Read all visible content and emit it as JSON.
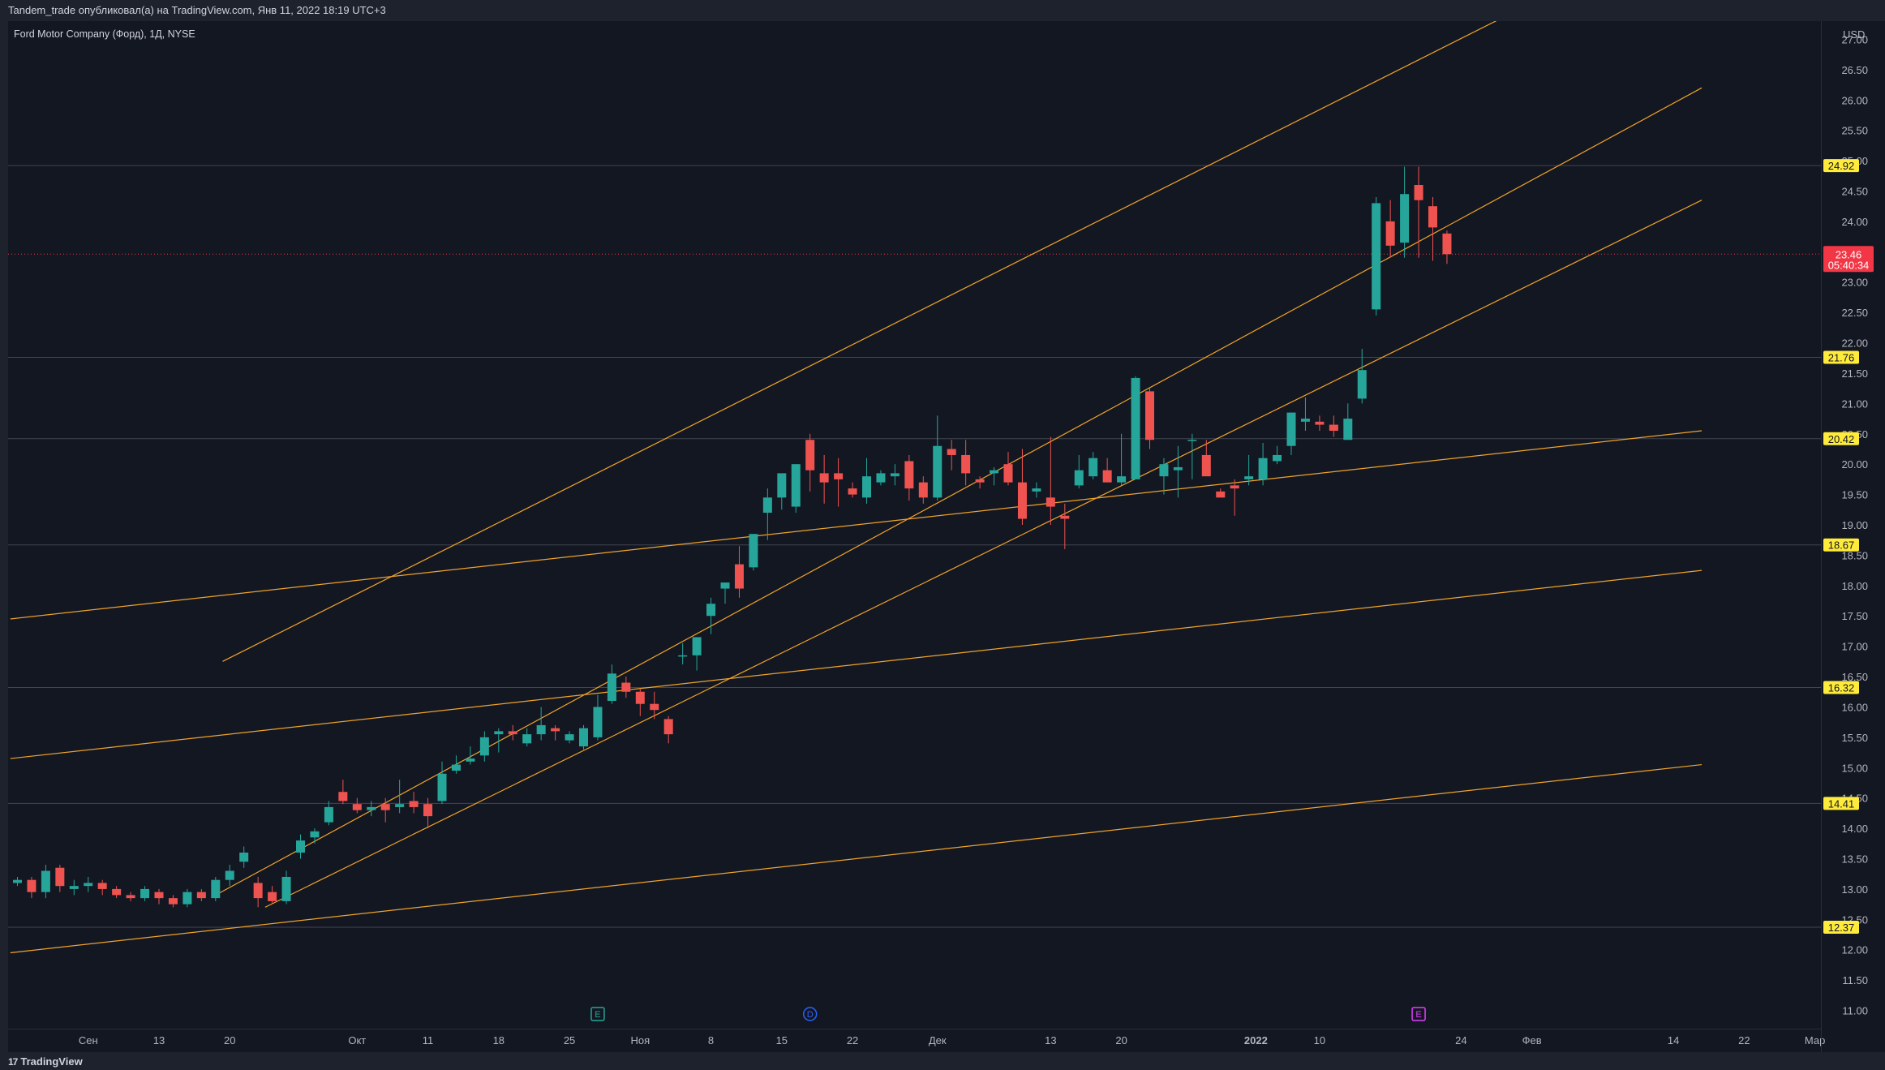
{
  "header": {
    "published": "Tandem_trade опубликовал(а) на TradingView.com, Янв 11, 2022 18:19 UTC+3"
  },
  "footer": {
    "brand": "TradingView"
  },
  "colors": {
    "up": "#26a69a",
    "down": "#ef5350",
    "trendline": "#f0a32a",
    "level_label": "#ffeb3b",
    "current": "#f23645",
    "background": "#131722"
  },
  "chart_data": {
    "type": "candlestick",
    "symbol": "Ford Motor Company (Форд), 1Д, NYSE",
    "currency": "USD",
    "ylim": [
      10.7,
      27.3
    ],
    "y_ticks": [
      "11.00",
      "11.50",
      "12.00",
      "12.50",
      "13.00",
      "13.50",
      "14.00",
      "14.50",
      "15.00",
      "15.50",
      "16.00",
      "16.50",
      "17.00",
      "17.50",
      "18.00",
      "18.50",
      "19.00",
      "19.50",
      "20.00",
      "20.50",
      "21.00",
      "21.50",
      "22.00",
      "22.50",
      "23.00",
      "23.50",
      "24.00",
      "24.50",
      "25.00",
      "25.50",
      "26.00",
      "26.50",
      "27.00"
    ],
    "x_ticks": [
      {
        "label": "Сен",
        "i": 5
      },
      {
        "label": "13",
        "i": 10
      },
      {
        "label": "20",
        "i": 15
      },
      {
        "label": "Окт",
        "i": 24
      },
      {
        "label": "11",
        "i": 29
      },
      {
        "label": "18",
        "i": 34
      },
      {
        "label": "25",
        "i": 39
      },
      {
        "label": "Ноя",
        "i": 44
      },
      {
        "label": "8",
        "i": 49
      },
      {
        "label": "15",
        "i": 54
      },
      {
        "label": "22",
        "i": 59
      },
      {
        "label": "Дек",
        "i": 65
      },
      {
        "label": "13",
        "i": 73
      },
      {
        "label": "20",
        "i": 78
      },
      {
        "label": "2022",
        "i": 87.5
      },
      {
        "label": "10",
        "i": 92
      },
      {
        "label": "24",
        "i": 102
      },
      {
        "label": "Фев",
        "i": 107
      },
      {
        "label": "14",
        "i": 117
      },
      {
        "label": "22",
        "i": 122
      },
      {
        "label": "Мар",
        "i": 127
      }
    ],
    "candles": [
      [
        13.1,
        13.2,
        13.05,
        13.15
      ],
      [
        13.15,
        13.2,
        12.85,
        12.95
      ],
      [
        12.95,
        13.4,
        12.85,
        13.3
      ],
      [
        13.35,
        13.4,
        12.95,
        13.05
      ],
      [
        13.0,
        13.15,
        12.9,
        13.05
      ],
      [
        13.05,
        13.2,
        12.95,
        13.1
      ],
      [
        13.1,
        13.15,
        12.9,
        13.0
      ],
      [
        13.0,
        13.05,
        12.85,
        12.9
      ],
      [
        12.9,
        12.95,
        12.8,
        12.85
      ],
      [
        12.85,
        13.05,
        12.8,
        13.0
      ],
      [
        12.95,
        13.0,
        12.75,
        12.85
      ],
      [
        12.85,
        12.9,
        12.7,
        12.75
      ],
      [
        12.75,
        13.0,
        12.7,
        12.95
      ],
      [
        12.95,
        13.0,
        12.8,
        12.85
      ],
      [
        12.85,
        13.2,
        12.8,
        13.15
      ],
      [
        13.15,
        13.4,
        13.05,
        13.3
      ],
      [
        13.45,
        13.7,
        13.35,
        13.6
      ],
      [
        13.1,
        13.2,
        12.7,
        12.85
      ],
      [
        12.95,
        13.05,
        12.75,
        12.8
      ],
      [
        12.8,
        13.3,
        12.75,
        13.2
      ],
      [
        13.6,
        13.9,
        13.5,
        13.8
      ],
      [
        13.85,
        14.0,
        13.75,
        13.95
      ],
      [
        14.1,
        14.45,
        14.05,
        14.35
      ],
      [
        14.6,
        14.8,
        14.4,
        14.45
      ],
      [
        14.4,
        14.5,
        14.25,
        14.3
      ],
      [
        14.3,
        14.45,
        14.2,
        14.35
      ],
      [
        14.4,
        14.5,
        14.1,
        14.3
      ],
      [
        14.35,
        14.8,
        14.25,
        14.4
      ],
      [
        14.45,
        14.6,
        14.25,
        14.35
      ],
      [
        14.4,
        14.5,
        14.0,
        14.2
      ],
      [
        14.45,
        15.1,
        14.4,
        14.9
      ],
      [
        14.95,
        15.2,
        14.9,
        15.05
      ],
      [
        15.1,
        15.35,
        15.05,
        15.15
      ],
      [
        15.2,
        15.6,
        15.1,
        15.5
      ],
      [
        15.55,
        15.65,
        15.25,
        15.6
      ],
      [
        15.6,
        15.7,
        15.45,
        15.55
      ],
      [
        15.4,
        15.65,
        15.35,
        15.55
      ],
      [
        15.55,
        16.0,
        15.45,
        15.7
      ],
      [
        15.65,
        15.7,
        15.45,
        15.6
      ],
      [
        15.45,
        15.6,
        15.4,
        15.55
      ],
      [
        15.35,
        15.7,
        15.3,
        15.65
      ],
      [
        15.5,
        16.2,
        15.45,
        16.0
      ],
      [
        16.1,
        16.7,
        16.05,
        16.55
      ],
      [
        16.4,
        16.5,
        16.15,
        16.25
      ],
      [
        16.25,
        16.3,
        15.85,
        16.05
      ],
      [
        16.05,
        16.25,
        15.8,
        15.95
      ],
      [
        15.8,
        15.85,
        15.4,
        15.55
      ],
      [
        16.85,
        17.05,
        16.7,
        16.85
      ],
      [
        16.85,
        17.15,
        16.6,
        17.15
      ],
      [
        17.5,
        17.8,
        17.2,
        17.7
      ],
      [
        17.95,
        18.0,
        17.7,
        18.05
      ],
      [
        18.35,
        18.65,
        17.8,
        17.95
      ],
      [
        18.3,
        18.85,
        18.25,
        18.85
      ],
      [
        19.2,
        19.6,
        18.75,
        19.45
      ],
      [
        19.45,
        19.8,
        19.25,
        19.85
      ],
      [
        19.3,
        20.0,
        19.2,
        20.0
      ],
      [
        20.4,
        20.5,
        19.55,
        19.9
      ],
      [
        19.85,
        20.15,
        19.35,
        19.7
      ],
      [
        19.85,
        20.1,
        19.3,
        19.75
      ],
      [
        19.6,
        19.7,
        19.45,
        19.5
      ],
      [
        19.45,
        20.1,
        19.35,
        19.8
      ],
      [
        19.7,
        19.9,
        19.65,
        19.85
      ],
      [
        19.8,
        20.0,
        19.65,
        19.85
      ],
      [
        20.05,
        20.15,
        19.4,
        19.6
      ],
      [
        19.7,
        19.8,
        19.35,
        19.45
      ],
      [
        19.45,
        20.8,
        19.4,
        20.3
      ],
      [
        20.25,
        20.4,
        19.9,
        20.15
      ],
      [
        20.15,
        20.4,
        19.65,
        19.85
      ],
      [
        19.75,
        19.8,
        19.6,
        19.7
      ],
      [
        19.85,
        19.95,
        19.65,
        19.9
      ],
      [
        20.0,
        20.2,
        19.65,
        19.7
      ],
      [
        19.7,
        20.25,
        19.0,
        19.1
      ],
      [
        19.55,
        19.7,
        19.45,
        19.6
      ],
      [
        19.45,
        20.45,
        19.0,
        19.3
      ],
      [
        19.15,
        19.35,
        18.6,
        19.1
      ],
      [
        19.65,
        20.15,
        19.6,
        19.9
      ],
      [
        19.8,
        20.2,
        19.75,
        20.1
      ],
      [
        19.9,
        20.1,
        19.7,
        19.7
      ],
      [
        19.7,
        20.5,
        19.65,
        19.8
      ],
      [
        19.75,
        21.45,
        19.75,
        21.42
      ],
      [
        21.2,
        21.25,
        20.25,
        20.4
      ],
      [
        19.8,
        20.1,
        19.5,
        20.0
      ],
      [
        19.9,
        20.3,
        19.45,
        19.95
      ],
      [
        20.4,
        20.5,
        19.75,
        20.4
      ],
      [
        20.15,
        20.4,
        19.95,
        19.8
      ],
      [
        19.55,
        19.6,
        19.5,
        19.45
      ],
      [
        19.65,
        19.75,
        19.15,
        19.6
      ],
      [
        19.75,
        20.15,
        19.65,
        19.8
      ],
      [
        19.75,
        20.35,
        19.65,
        20.1
      ],
      [
        20.05,
        20.3,
        20.0,
        20.15
      ],
      [
        20.3,
        20.85,
        20.15,
        20.85
      ],
      [
        20.7,
        21.1,
        20.55,
        20.75
      ],
      [
        20.7,
        20.8,
        20.55,
        20.65
      ],
      [
        20.65,
        20.8,
        20.45,
        20.55
      ],
      [
        20.4,
        21.0,
        20.4,
        20.75
      ],
      [
        21.08,
        21.9,
        21.0,
        21.55
      ],
      [
        22.55,
        24.4,
        22.45,
        24.3
      ],
      [
        24.0,
        24.35,
        23.4,
        23.6
      ],
      [
        23.65,
        24.9,
        23.4,
        24.45
      ],
      [
        24.6,
        24.9,
        23.4,
        24.35
      ],
      [
        24.25,
        24.4,
        23.35,
        23.9
      ],
      [
        23.8,
        23.85,
        23.3,
        23.46
      ]
    ],
    "trendlines": [
      {
        "i0": 14.5,
        "p0": 16.75,
        "i1": 107,
        "p1": 27.6
      },
      {
        "i0": 14,
        "p0": 12.9,
        "i1": 119,
        "p1": 26.2
      },
      {
        "i0": 17.5,
        "p0": 12.7,
        "i1": 119,
        "p1": 24.35
      },
      {
        "i0": -0.5,
        "p0": 17.45,
        "i1": 119,
        "p1": 20.55
      },
      {
        "i0": -0.5,
        "p0": 15.15,
        "i1": 119,
        "p1": 18.25
      },
      {
        "i0": -0.5,
        "p0": 11.95,
        "i1": 119,
        "p1": 15.05
      }
    ],
    "levels": [
      {
        "label": "24.92",
        "value": 24.92
      },
      {
        "label": "21.76",
        "value": 21.76
      },
      {
        "label": "20.42",
        "value": 20.42
      },
      {
        "label": "18.67",
        "value": 18.67
      },
      {
        "label": "16.32",
        "value": 16.32
      },
      {
        "label": "14.41",
        "value": 14.41
      },
      {
        "label": "12.37",
        "value": 12.37
      }
    ],
    "current": {
      "label": "23.46",
      "countdown": "05:40:34",
      "value": 23.46
    },
    "events": [
      {
        "letter": "E",
        "i": 41,
        "color": "#26a69a"
      },
      {
        "letter": "D",
        "i": 56,
        "color": "#2962ff"
      },
      {
        "letter": "E",
        "i": 99,
        "color": "#e040fb"
      }
    ]
  }
}
